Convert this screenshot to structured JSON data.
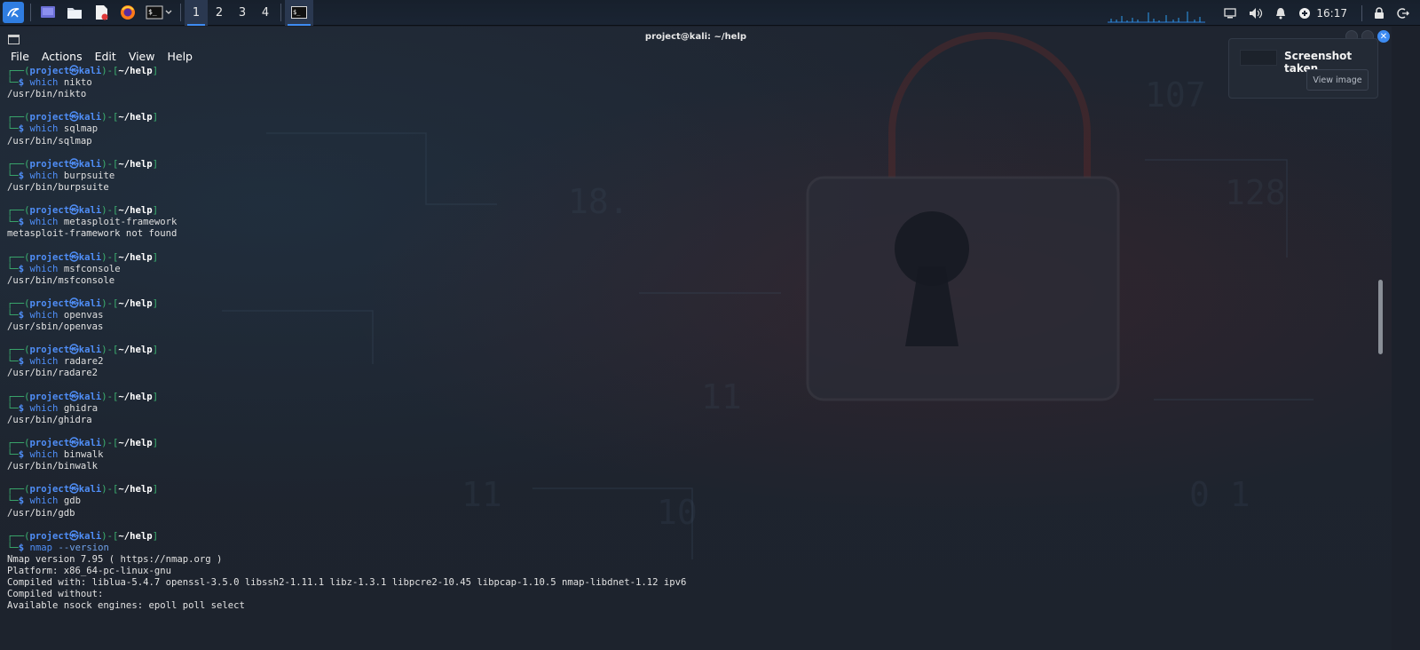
{
  "taskbar": {
    "launchers": [
      {
        "name": "kali-menu-icon"
      },
      {
        "name": "desktop-icon"
      },
      {
        "name": "file-manager-icon"
      },
      {
        "name": "text-editor-icon"
      },
      {
        "name": "firefox-icon"
      },
      {
        "name": "terminal-icon"
      }
    ],
    "workspaces": [
      "1",
      "2",
      "3",
      "4"
    ],
    "active_workspace": "1",
    "clock": "16:17"
  },
  "window": {
    "title": "project@kali: ~/help",
    "menu": [
      "File",
      "Actions",
      "Edit",
      "View",
      "Help"
    ]
  },
  "notification": {
    "title": "Screenshot taken",
    "button": "View image"
  },
  "prompt": {
    "user": "project",
    "host": "kali",
    "path": "~/help"
  },
  "terminal": {
    "blocks": [
      {
        "cmd": "which",
        "arg": "nikto",
        "output": [
          "/usr/bin/nikto"
        ]
      },
      {
        "cmd": "which",
        "arg": "sqlmap",
        "output": [
          "/usr/bin/sqlmap"
        ]
      },
      {
        "cmd": "which",
        "arg": "burpsuite",
        "output": [
          "/usr/bin/burpsuite"
        ]
      },
      {
        "cmd": "which",
        "arg": "metasploit-framework",
        "output": [
          "metasploit-framework not found"
        ]
      },
      {
        "cmd": "which",
        "arg": "msfconsole",
        "output": [
          "/usr/bin/msfconsole"
        ]
      },
      {
        "cmd": "which",
        "arg": "openvas",
        "output": [
          "/usr/sbin/openvas"
        ]
      },
      {
        "cmd": "which",
        "arg": "radare2",
        "output": [
          "/usr/bin/radare2"
        ]
      },
      {
        "cmd": "which",
        "arg": "ghidra",
        "output": [
          "/usr/bin/ghidra"
        ]
      },
      {
        "cmd": "which",
        "arg": "binwalk",
        "output": [
          "/usr/bin/binwalk"
        ]
      },
      {
        "cmd": "which",
        "arg": "gdb",
        "output": [
          "/usr/bin/gdb"
        ]
      },
      {
        "cmd": "nmap",
        "arg": "--version",
        "output": [
          "Nmap version 7.95 ( https://nmap.org )",
          "Platform: x86_64-pc-linux-gnu",
          "Compiled with: liblua-5.4.7 openssl-3.5.0 libssh2-1.11.1 libz-1.3.1 libpcre2-10.45 libpcap-1.10.5 nmap-libdnet-1.12 ipv6",
          "Compiled without:",
          "Available nsock engines: epoll poll select"
        ]
      }
    ]
  }
}
